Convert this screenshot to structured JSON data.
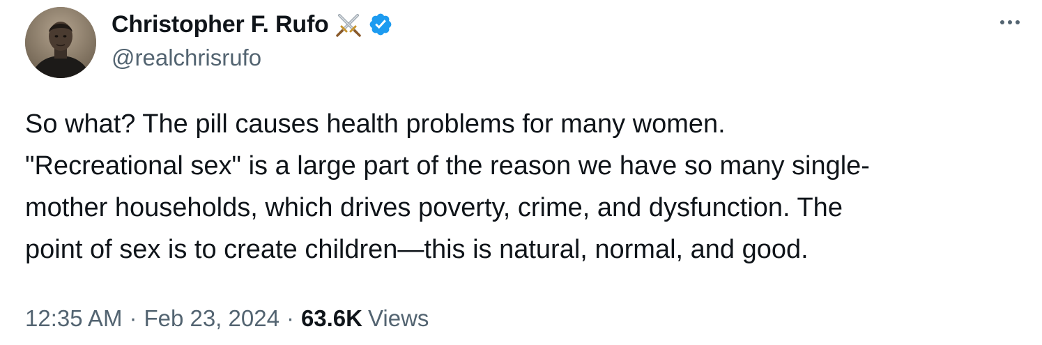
{
  "author": {
    "display_name": "Christopher F. Rufo",
    "name_emoji_icon": "crossed-swords-icon",
    "verified_icon": "verified-badge-icon",
    "handle": "@realchrisrufo"
  },
  "tweet": {
    "lines": [
      "So what? The pill causes health problems for many women.",
      "\"Recreational sex\" is a large part of the reason we have so many single-",
      "mother households, which drives poverty, crime, and dysfunction. The",
      "point of sex is to create children—this is natural, normal, and good."
    ],
    "time": "12:35 AM",
    "separator": "·",
    "date": "Feb 23, 2024",
    "views_count": "63.6K",
    "views_label": "Views"
  },
  "more_icon": "more-options-icon",
  "colors": {
    "text_primary": "#0f1419",
    "text_secondary": "#536471",
    "verified_blue": "#1d9bf0"
  }
}
